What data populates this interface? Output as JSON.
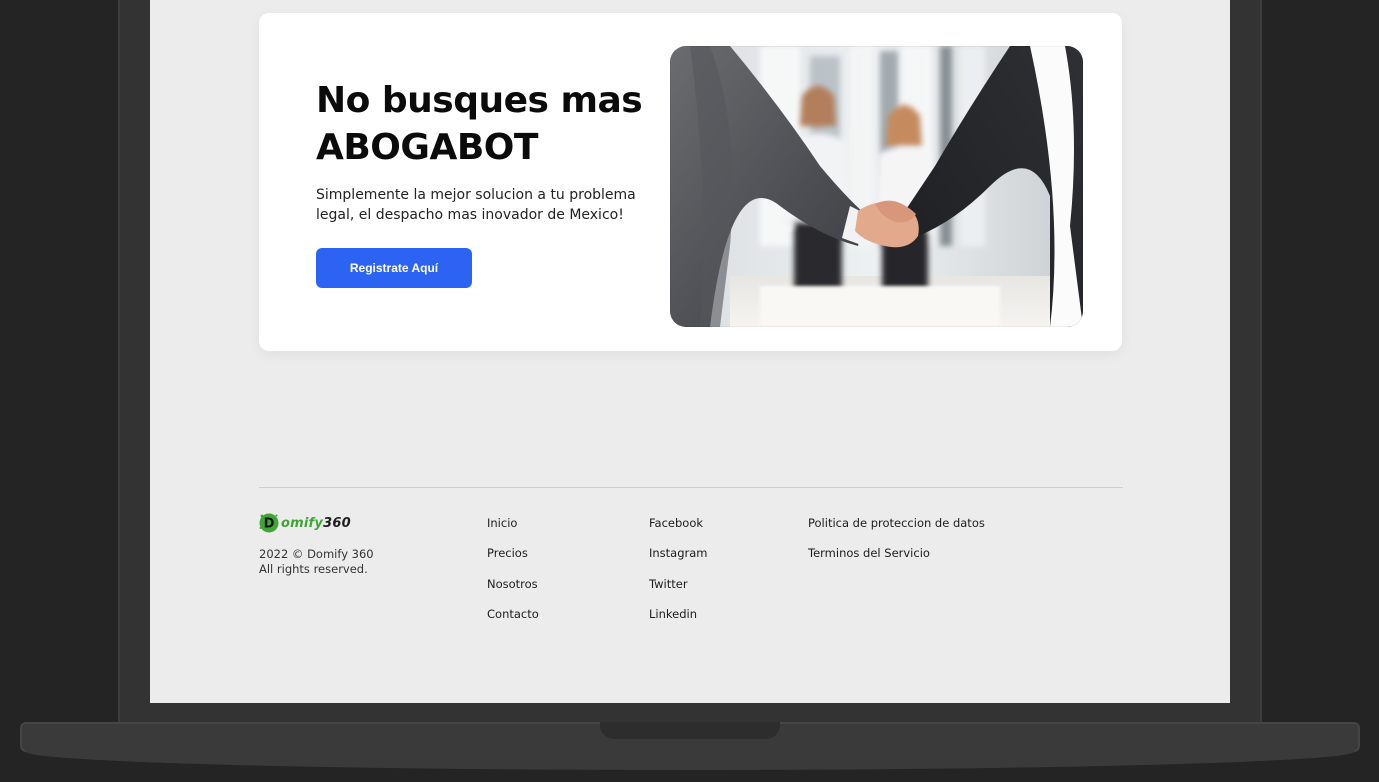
{
  "hero": {
    "title_line1": "No busques mas",
    "title_line2": "ABOGABOT",
    "subtitle": "Simplemente la mejor solucion a tu problema legal, el despacho mas inovador de Mexico!",
    "cta_label": "Registrate Aquí",
    "cta_color": "#2d63f2",
    "image": "handshake-photo"
  },
  "footer": {
    "logo": {
      "text": "omify",
      "number": "360",
      "brand_color": "#3fa535"
    },
    "copyright_line1": "2022 © Domify 360",
    "copyright_line2": "All rights reserved.",
    "nav_links": [
      "Inicio",
      "Precios",
      "Nosotros",
      "Contacto"
    ],
    "social_links": [
      "Facebook",
      "Instagram",
      "Twitter",
      "Linkedin"
    ],
    "legal_links": [
      "Politica de proteccion de datos",
      "Terminos del Servicio"
    ]
  }
}
